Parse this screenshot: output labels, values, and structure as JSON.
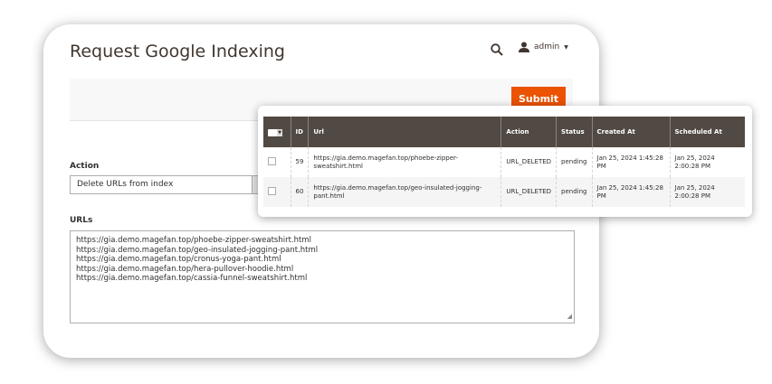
{
  "header": {
    "title": "Request Google Indexing",
    "user": "admin"
  },
  "toolbar": {
    "submit_label": "Submit"
  },
  "form": {
    "action_label": "Action",
    "action_value": "Delete URLs from index",
    "urls_label": "URLs",
    "urls_value": "https://gia.demo.magefan.top/phoebe-zipper-sweatshirt.html\nhttps://gia.demo.magefan.top/geo-insulated-jogging-pant.html\nhttps://gia.demo.magefan.top/cronus-yoga-pant.html\nhttps://gia.demo.magefan.top/hera-pullover-hoodie.html\nhttps://gia.demo.magefan.top/cassia-funnel-sweatshirt.html"
  },
  "grid": {
    "columns": [
      "ID",
      "Url",
      "Action",
      "Status",
      "Created At",
      "Scheduled At"
    ],
    "rows": [
      {
        "id": "59",
        "url": "https://gia.demo.magefan.top/phoebe-zipper-sweatshirt.html",
        "action": "URL_DELETED",
        "status": "pending",
        "created": "Jan 25, 2024 1:45:28 PM",
        "scheduled": "Jan 25, 2024 2:00:28 PM"
      },
      {
        "id": "60",
        "url": "https://gia.demo.magefan.top/geo-insulated-jogging-pant.html",
        "action": "URL_DELETED",
        "status": "pending",
        "created": "Jan 25, 2024 1:45:28 PM",
        "scheduled": "Jan 25, 2024 2:00:28 PM"
      }
    ]
  },
  "colors": {
    "accent": "#eb5202",
    "grid_header": "#514943"
  }
}
